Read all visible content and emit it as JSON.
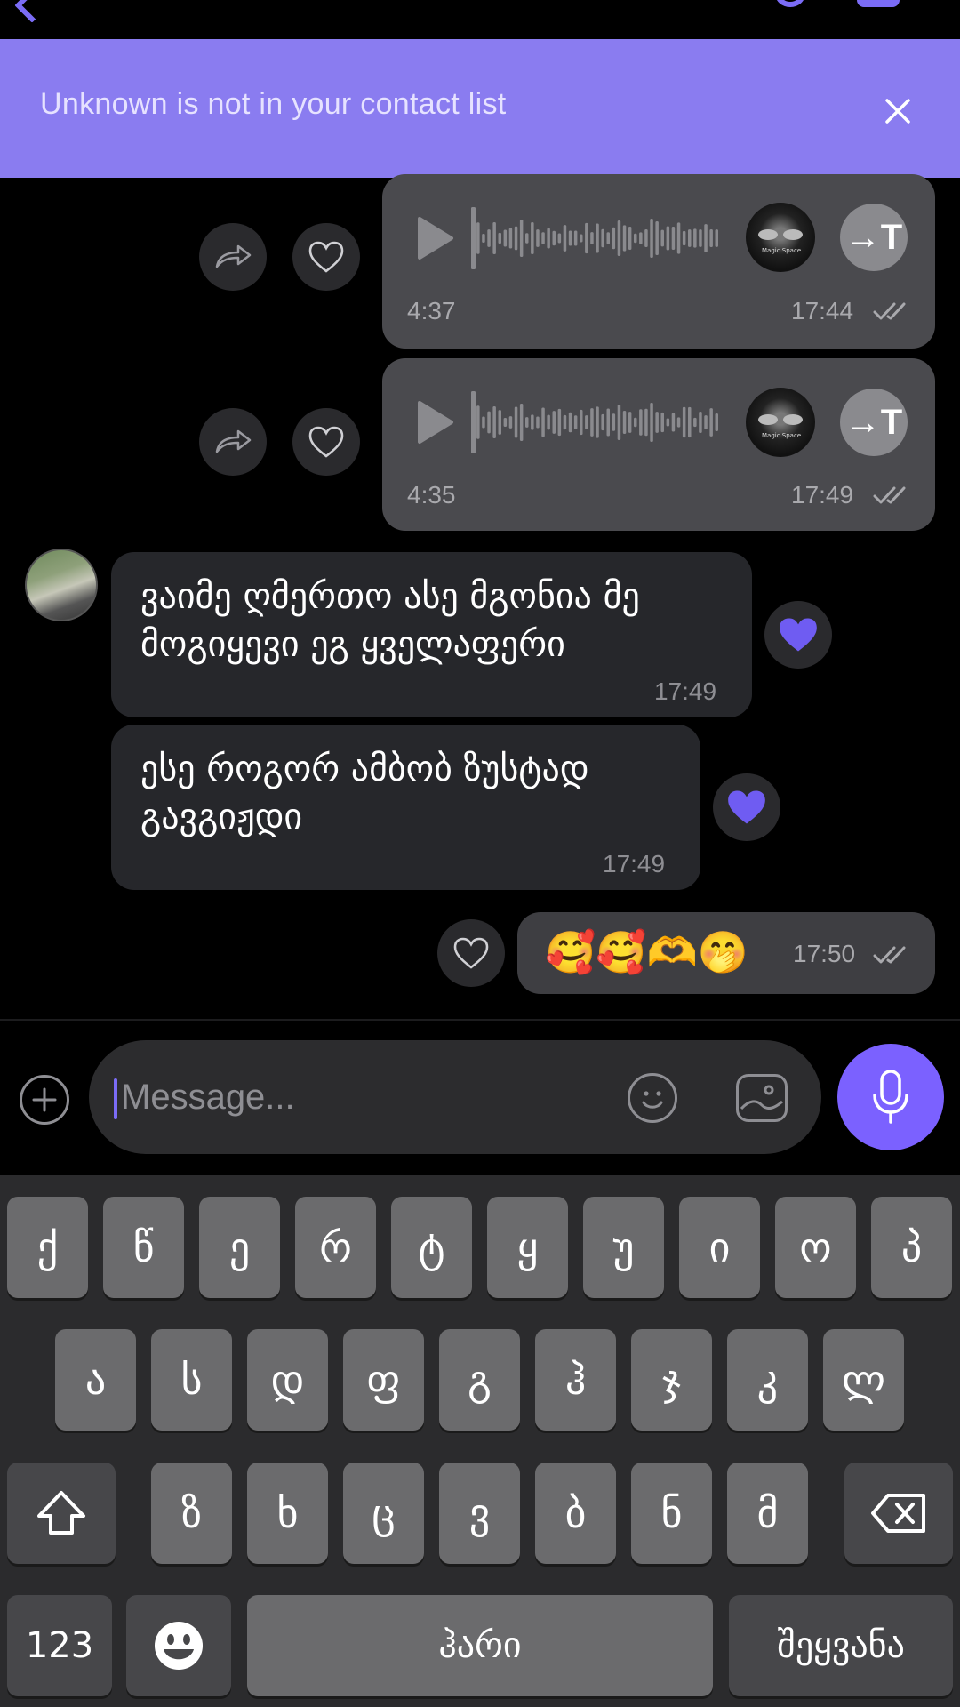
{
  "banner": {
    "text": "Unknown is not in your contact list"
  },
  "voice_messages": [
    {
      "duration": "4:37",
      "time": "17:44",
      "thumb_label": "Magic Space"
    },
    {
      "duration": "4:35",
      "time": "17:49",
      "thumb_label": "Magic Space"
    }
  ],
  "transcribe_label": "→T",
  "incoming": [
    {
      "text": "ვაიმე ღმერთო ასე მგონია მე მოგიყევი ეგ ყველაფერი",
      "time": "17:49"
    },
    {
      "text": "ესე როგორ ამბობ ზუსტად გავგიჟდი",
      "time": "17:49"
    }
  ],
  "outgoing_emoji": {
    "emojis": "🥰🥰🫶🤭",
    "time": "17:50"
  },
  "input": {
    "placeholder": "Message..."
  },
  "keyboard": {
    "row1": [
      "ქ",
      "წ",
      "ე",
      "რ",
      "ტ",
      "ყ",
      "უ",
      "ი",
      "ო",
      "პ"
    ],
    "row2": [
      "ა",
      "ს",
      "დ",
      "ფ",
      "გ",
      "ჰ",
      "ჯ",
      "კ",
      "ლ"
    ],
    "row3": [
      "ზ",
      "ხ",
      "ც",
      "ვ",
      "ბ",
      "ნ",
      "მ"
    ],
    "numbers_label": "123",
    "space_label": "ჰარი",
    "return_label": "შეყვანა"
  },
  "colors": {
    "accent": "#7b61ff",
    "banner": "#8a7cf0",
    "heart": "#6f5cf2"
  }
}
